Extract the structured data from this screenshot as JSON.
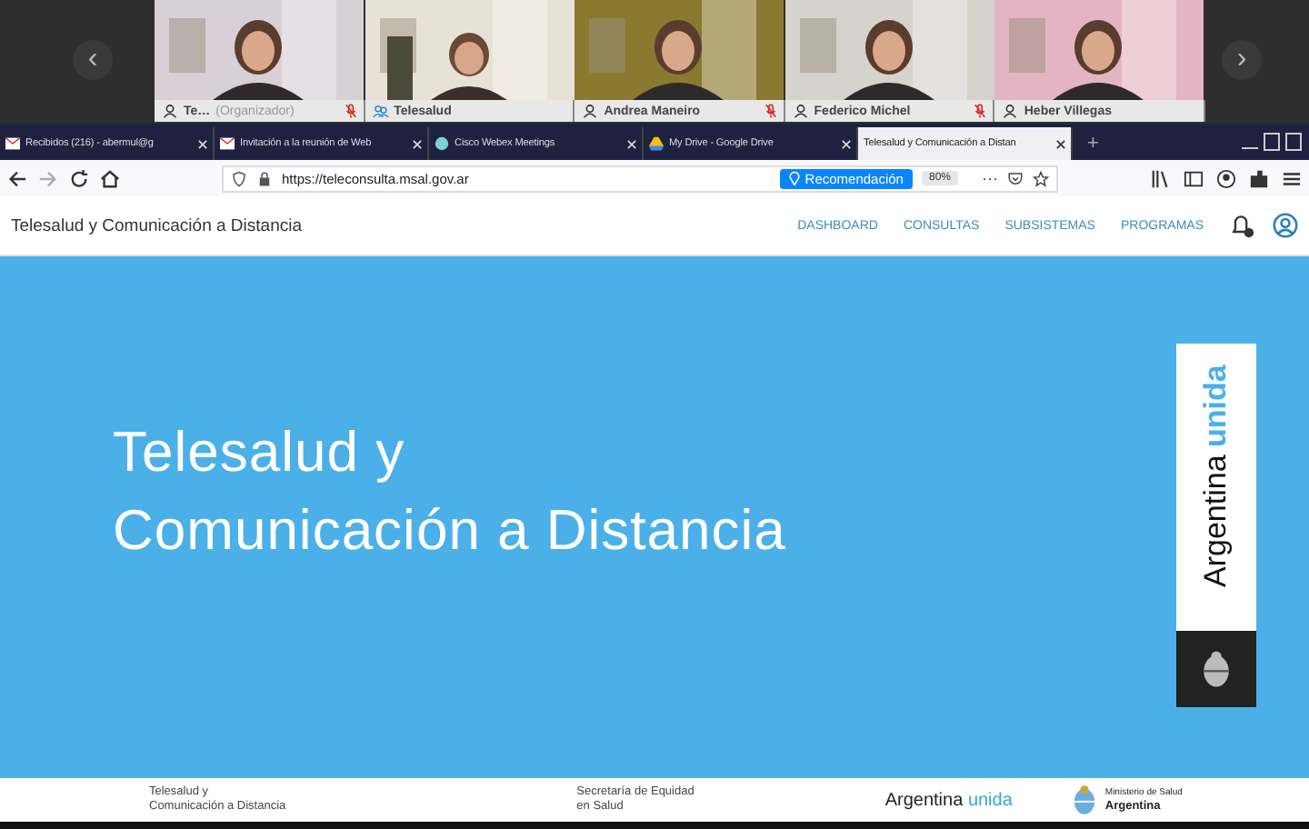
{
  "video_strip": {
    "prev": "‹",
    "next": "›",
    "participants": [
      {
        "name": "Te…",
        "role": "(Organizador)",
        "muted": true,
        "kind": "person"
      },
      {
        "name": "Telesalud",
        "muted": false,
        "kind": "room"
      },
      {
        "name": "Andrea Maneiro",
        "muted": true,
        "kind": "person"
      },
      {
        "name": "Federico Michel",
        "muted": true,
        "kind": "person"
      },
      {
        "name": "Heber Villegas",
        "muted": false,
        "kind": "person"
      }
    ]
  },
  "browser": {
    "tabs": [
      {
        "label": "Recibidos (216) - abermul@g",
        "selected": false,
        "kind": "mail"
      },
      {
        "label": "Invitación a la reunión de Web",
        "selected": false,
        "kind": "mail"
      },
      {
        "label": "Cisco Webex Meetings",
        "selected": false,
        "kind": "webex"
      },
      {
        "label": "My Drive - Google Drive",
        "selected": false,
        "kind": "drive"
      },
      {
        "label": "Telesalud y Comunicación a Distan",
        "selected": true,
        "kind": "page"
      }
    ],
    "new_tab": "+",
    "url": "https://teleconsulta.msal.gov.ar",
    "recommendation": "Recomendación",
    "zoom": "80%",
    "more": "···"
  },
  "site": {
    "brand": "Telesalud y Comunicación a Distancia",
    "nav": [
      "DASHBOARD",
      "CONSULTAS",
      "SUBSISTEMAS",
      "PROGRAMAS"
    ],
    "hero_title": [
      "Telesalud y",
      "Comunicación a Distancia"
    ],
    "banner": {
      "word": "Argentina",
      "accent": "unida"
    },
    "footer": {
      "brand": [
        "Telesalud y",
        "Comunicación a Distancia"
      ],
      "secretaria": [
        "Secretaría de Equidad",
        "en Salud"
      ],
      "logo": {
        "word": "Argentina",
        "accent": "unida"
      },
      "ministry": [
        "Ministerio de Salud",
        "Argentina"
      ]
    }
  }
}
